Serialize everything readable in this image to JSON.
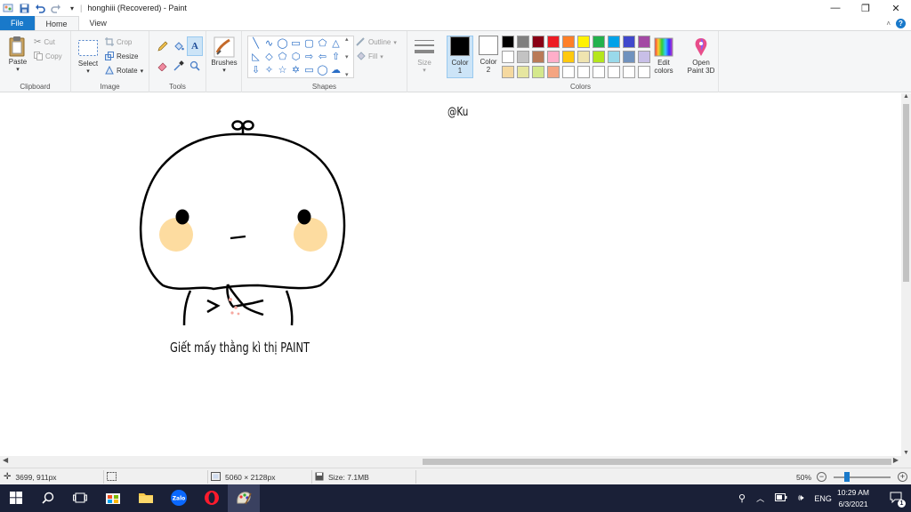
{
  "window": {
    "title": "honghiii (Recovered) - Paint",
    "controls": {
      "minimize": "—",
      "maximize": "❐",
      "close": "✕"
    }
  },
  "quick_access": {
    "icons": [
      "paint-app-icon",
      "save-icon",
      "undo-icon",
      "redo-icon",
      "customize-dropdown-icon"
    ]
  },
  "tabs": [
    {
      "label": "File"
    },
    {
      "label": "Home"
    },
    {
      "label": "View"
    }
  ],
  "help": {
    "label": "?"
  },
  "ribbon": {
    "clipboard": {
      "group_label": "Clipboard",
      "paste": "Paste",
      "cut": "Cut",
      "copy": "Copy"
    },
    "image": {
      "group_label": "Image",
      "select": "Select",
      "crop": "Crop",
      "resize": "Resize",
      "rotate": "Rotate"
    },
    "tools": {
      "group_label": "Tools"
    },
    "brushes": {
      "label": "Brushes"
    },
    "shapes": {
      "group_label": "Shapes",
      "outline": "Outline",
      "fill": "Fill"
    },
    "size": {
      "label": "Size"
    },
    "colors": {
      "group_label": "Colors",
      "color1_label": "Color",
      "color1_num": "1",
      "color2_label": "Color",
      "color2_num": "2",
      "color1": "#000000",
      "color2": "#ffffff",
      "palette": [
        "#000000",
        "#7f7f7f",
        "#880015",
        "#ed1c24",
        "#ff7f27",
        "#fff200",
        "#22b14c",
        "#00a2e8",
        "#3f48cc",
        "#a349a4",
        "#ffffff",
        "#c3c3c3",
        "#b97a57",
        "#ffaec9",
        "#ffc90e",
        "#efe4b0",
        "#b5e61d",
        "#99d9ea",
        "#7092be",
        "#c8bfe7",
        "#f5d9a0",
        "#e6e6a0",
        "#d4e88c",
        "#f4a582",
        "#ffffff",
        "#ffffff",
        "#ffffff",
        "#ffffff",
        "#ffffff",
        "#ffffff"
      ],
      "edit_colors": "Edit colors"
    },
    "paint3d": {
      "label": "Open Paint 3D"
    }
  },
  "canvas": {
    "signature": "@Ku",
    "caption": "Giết mấy thằng kì thị PAINT"
  },
  "status": {
    "cursor": "3699, 911px",
    "dimensions": "5060 × 2128px",
    "size": "Size: 7.1MB",
    "zoom": "50%"
  },
  "taskbar": {
    "language": "ENG",
    "time": "10:29 AM",
    "date": "6/3/2021",
    "notification_count": "1"
  }
}
